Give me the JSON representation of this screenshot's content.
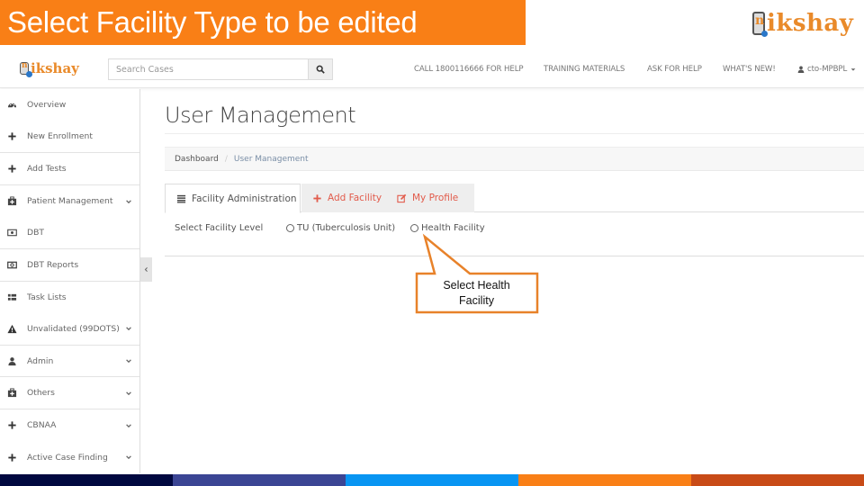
{
  "slide": {
    "title": "Select Facility Type to be edited",
    "banner_color": "#f97f16",
    "brand_logo": {
      "icon": "phone-touch-icon",
      "letter": "n",
      "word": "ikshay"
    }
  },
  "header": {
    "logo": {
      "icon": "phone-touch-icon",
      "letter": "n",
      "word": "ikshay"
    },
    "search": {
      "placeholder": "Search Cases",
      "value": "",
      "button_icon": "search-icon"
    },
    "nav": {
      "call": "CALL 1800116666 FOR HELP",
      "training": "TRAINING MATERIALS",
      "ask": "ASK FOR HELP",
      "whats_new": "WHAT'S NEW!",
      "user": "cto-MPBPL",
      "user_icon": "user-icon",
      "user_caret": "caret-down-icon"
    }
  },
  "sidebar": {
    "items": [
      {
        "label": "Overview",
        "icon": "dashboard-icon",
        "has_submenu": false
      },
      {
        "label": "New Enrollment",
        "icon": "plus-icon",
        "has_submenu": false
      },
      {
        "label": "Add Tests",
        "icon": "plus-icon",
        "has_submenu": false
      },
      {
        "label": "Patient Management",
        "icon": "medkit-icon",
        "has_submenu": true
      },
      {
        "label": "DBT",
        "icon": "money-icon",
        "has_submenu": false
      },
      {
        "label": "DBT Reports",
        "icon": "money-icon",
        "has_submenu": false
      },
      {
        "label": "Task Lists",
        "icon": "list-icon",
        "has_submenu": false
      },
      {
        "label": "Unvalidated (99DOTS)",
        "icon": "warning-icon",
        "has_submenu": true
      },
      {
        "label": "Admin",
        "icon": "user-icon",
        "has_submenu": true
      },
      {
        "label": "Others",
        "icon": "medkit-icon",
        "has_submenu": true
      },
      {
        "label": "CBNAA",
        "icon": "plus-icon",
        "has_submenu": true
      },
      {
        "label": "Active Case Finding",
        "icon": "plus-icon",
        "has_submenu": true
      }
    ],
    "toggle_icon": "chevron-left-icon"
  },
  "main": {
    "page_title": "User Management",
    "breadcrumb": {
      "home": "Dashboard",
      "separator": "/",
      "current": "User Management"
    },
    "tabs": [
      {
        "label": "Facility Administration",
        "icon": "list-icon",
        "active": true
      },
      {
        "label": "Add Facility",
        "icon": "plus-icon",
        "active": false
      },
      {
        "label": "My Profile",
        "icon": "edit-icon",
        "active": false
      }
    ],
    "facility_level": {
      "label": "Select Facility Level",
      "options": [
        {
          "label": "TU (Tuberculosis Unit)",
          "selected": false
        },
        {
          "label": "Health Facility",
          "selected": false
        }
      ]
    }
  },
  "callout": {
    "text_line1": "Select Health",
    "text_line2": "Facility",
    "color": "#e8822a"
  },
  "footer_colors": [
    "#000840",
    "#3b4594",
    "#0895f2",
    "#f97f16",
    "#c84b17"
  ]
}
